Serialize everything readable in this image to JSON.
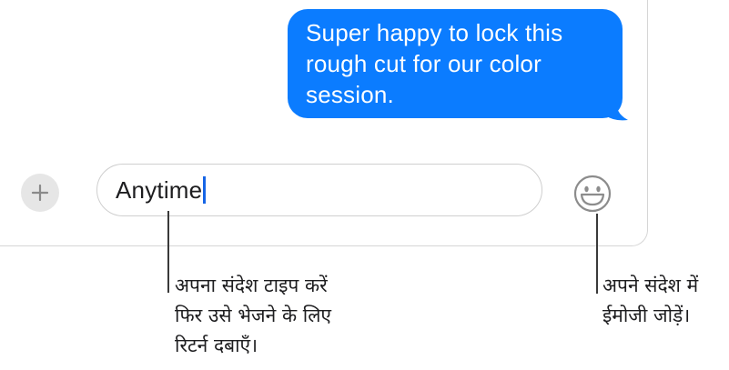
{
  "conversation": {
    "messages": [
      {
        "sender": "me",
        "lines": [
          "Super happy to lock this",
          "rough cut for our color",
          "session."
        ]
      }
    ],
    "bubble_color": "#0b7cff"
  },
  "composer": {
    "add_icon": "plus-icon",
    "input_value": "Anytime",
    "emoji_icon": "smiley-emoji-icon"
  },
  "callouts": {
    "message_input": {
      "lines": [
        "अपना संदेश टाइप करें",
        "फिर उसे भेजने के लिए",
        "रिटर्न दबाएँ।"
      ]
    },
    "emoji": {
      "lines": [
        "अपने संदेश में",
        "ईमोजी जोड़ें।"
      ]
    }
  }
}
